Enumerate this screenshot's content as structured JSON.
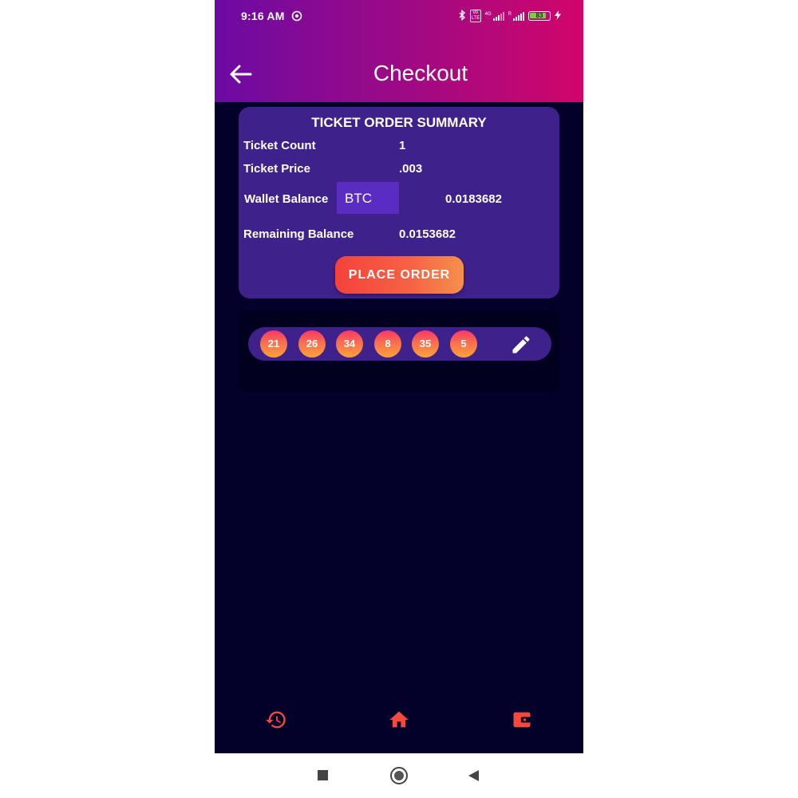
{
  "status_bar": {
    "time": "9:16 AM",
    "volte": "Vo LTE",
    "net1": "4G",
    "net2": "R",
    "battery": "83"
  },
  "header": {
    "title": "Checkout"
  },
  "summary": {
    "heading": "TICKET ORDER SUMMARY",
    "ticket_count_label": "Ticket Count",
    "ticket_count_value": "1",
    "ticket_price_label": "Ticket Price",
    "ticket_price_value": ".003",
    "wallet_balance_label": "Wallet Balance",
    "currency": "BTC",
    "wallet_balance_value": "0.0183682",
    "remaining_balance_label": "Remaining Balance",
    "remaining_balance_value": "0.0153682",
    "place_order_label": "PLACE ORDER"
  },
  "ticket_numbers": [
    "21",
    "26",
    "34",
    "8",
    "35",
    "5"
  ],
  "bottom_nav": {
    "icons": [
      "history-icon",
      "home-icon",
      "wallet-icon"
    ],
    "accent": "#f4493c"
  },
  "colors": {
    "background": "#03012a",
    "card": "#3e218b",
    "header_gradient_start": "#6c0aa3",
    "header_gradient_end": "#d2056a"
  }
}
